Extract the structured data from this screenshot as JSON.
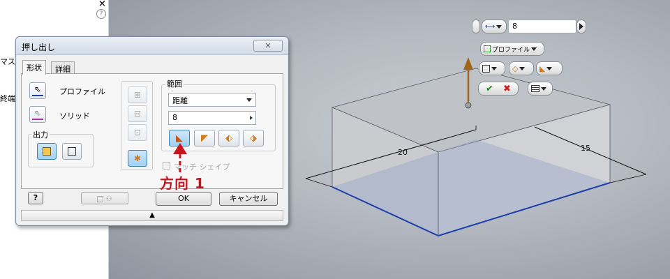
{
  "side_panel": {
    "lines": [
      "マスタ",
      "終端"
    ],
    "close_glyph": "×",
    "help_glyph": "?"
  },
  "mini_toolbar": {
    "distance_value": "8",
    "profile_label": "プロファイル"
  },
  "dimensions": {
    "length": "20",
    "width": "15"
  },
  "dialog": {
    "title": "押し出し",
    "close_glyph": "✕",
    "tabs": [
      "形状",
      "詳細"
    ],
    "profile_label": "プロファイル",
    "solid_label": "ソリッド",
    "output_group": "出力",
    "extent_group": "範囲",
    "extent_type": "距離",
    "distance_value": "8",
    "match_shape_label": "マッチ シェイプ",
    "ok_label": "OK",
    "cancel_label": "キャンセル",
    "help_glyph": "?",
    "expand_glyph": "▲"
  },
  "annotation": {
    "label": "方向 1",
    "color": "#c8141e"
  },
  "colors": {
    "accent_blue": "#1e3fa8",
    "arrow_brown": "#a0651a",
    "ok_green": "#1a8f1a",
    "cancel_red": "#cc1f1f"
  }
}
